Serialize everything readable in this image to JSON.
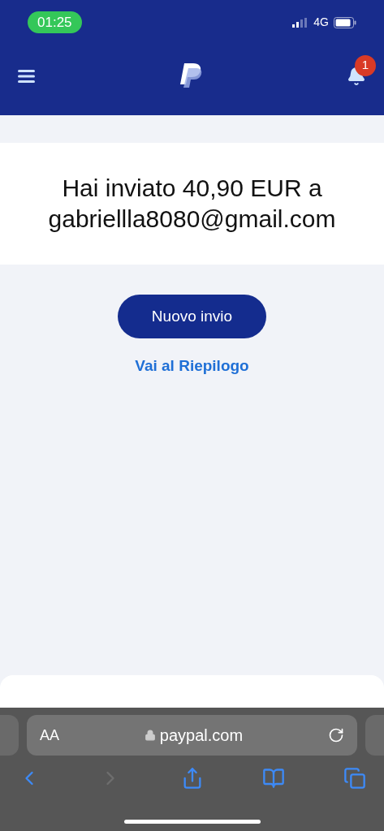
{
  "status_bar": {
    "time": "01:25",
    "network": "4G"
  },
  "header": {
    "notification_count": "1"
  },
  "confirmation": {
    "message": "Hai inviato 40,90 EUR a gabriellla8080@gmail.com"
  },
  "actions": {
    "primary_button": "Nuovo invio",
    "link": "Vai al Riepilogo"
  },
  "browser": {
    "text_size": "AA",
    "url": "paypal.com",
    "toolbar": [
      {
        "kind": "back",
        "disabled": false
      },
      {
        "kind": "forward",
        "disabled": true
      },
      {
        "kind": "share",
        "disabled": false
      },
      {
        "kind": "bookmarks",
        "disabled": false
      },
      {
        "kind": "tabs",
        "disabled": false
      }
    ]
  }
}
